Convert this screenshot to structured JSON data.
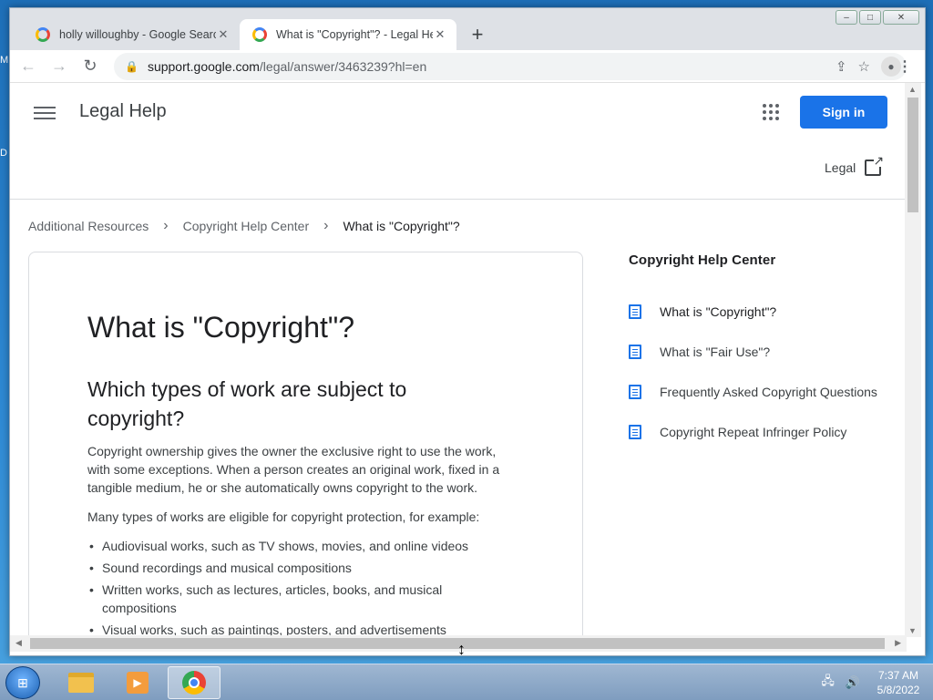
{
  "desktop": {
    "edge_labels": [
      "M",
      "D"
    ]
  },
  "window": {
    "controls": {
      "minimize": "–",
      "maximize": "□",
      "close": "✕"
    }
  },
  "tabs": [
    {
      "title": "holly willoughby - Google Search",
      "close": "✕"
    },
    {
      "title": "What is \"Copyright\"? - Legal Help",
      "close": "✕"
    }
  ],
  "newtab_label": "+",
  "toolbar": {
    "back": "←",
    "forward": "→",
    "reload": "↻",
    "url_host": "support.google.com",
    "url_path": "/legal/answer/3463239?hl=en",
    "share": "⇪",
    "bookmark": "☆",
    "menu": "⋮"
  },
  "header": {
    "title": "Legal Help",
    "signin": "Sign in",
    "legal_link": "Legal"
  },
  "breadcrumb": {
    "items": [
      "Additional Resources",
      "Copyright Help Center",
      "What is \"Copyright\"?"
    ],
    "separator": "›"
  },
  "article": {
    "title": "What is \"Copyright\"?",
    "subtitle": "Which types of work are subject to copyright?",
    "p1": "Copyright ownership gives the owner the exclusive right to use the work, with some exceptions. When a person creates an original work, fixed in a tangible medium, he or she automatically owns copyright to the work.",
    "p2": "Many types of works are eligible for copyright protection, for example:",
    "bullets": [
      "Audiovisual works, such as TV shows, movies, and online videos",
      "Sound recordings and musical compositions",
      "Written works, such as lectures, articles, books, and musical compositions",
      "Visual works, such as paintings, posters, and advertisements"
    ]
  },
  "sidebar": {
    "title": "Copyright Help Center",
    "items": [
      "What is \"Copyright\"?",
      "What is \"Fair Use\"?",
      "Frequently Asked Copyright Questions",
      "Copyright Repeat Infringer Policy"
    ]
  },
  "taskbar": {
    "time": "7:37 AM",
    "date": "5/8/2022"
  }
}
